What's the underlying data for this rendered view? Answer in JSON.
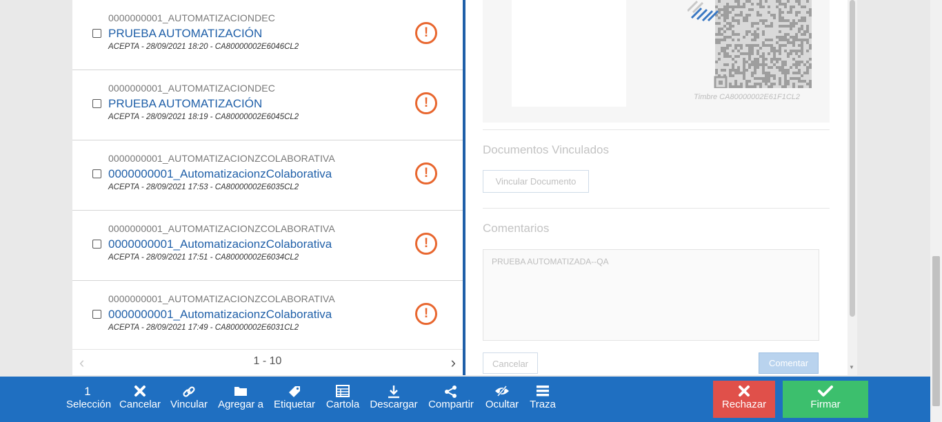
{
  "documents": [
    {
      "code": "0000000001_AUTOMATIZACIONDEC",
      "title": "PRUEBA AUTOMATIZACIÓN",
      "meta": "ACEPTA - 28/09/2021 18:20 - CA80000002E6046CL2"
    },
    {
      "code": "0000000001_AUTOMATIZACIONDEC",
      "title": "PRUEBA AUTOMATIZACIÓN",
      "meta": "ACEPTA - 28/09/2021 18:19 - CA80000002E6045CL2"
    },
    {
      "code": "0000000001_AUTOMATIZACIONZCOLABORATIVA",
      "title": "0000000001_AutomatizacionzColaborativa",
      "meta": "ACEPTA - 28/09/2021 17:53 - CA80000002E6035CL2"
    },
    {
      "code": "0000000001_AUTOMATIZACIONZCOLABORATIVA",
      "title": "0000000001_AutomatizacionzColaborativa",
      "meta": "ACEPTA - 28/09/2021 17:51 - CA80000002E6034CL2"
    },
    {
      "code": "0000000001_AUTOMATIZACIONZCOLABORATIVA",
      "title": "0000000001_AutomatizacionzColaborativa",
      "meta": "ACEPTA - 28/09/2021 17:49 - CA80000002E6031CL2"
    }
  ],
  "alert_glyph": "!",
  "pager": {
    "range": "1 - 10",
    "prev": "‹",
    "next": "›"
  },
  "detail": {
    "timbre": "Timbre CA80000002E61F1CL2",
    "linked_title": "Documentos Vinculados",
    "link_button": "Vincular Documento",
    "comments_title": "Comentarios",
    "comment_text": "PRUEBA AUTOMATIZADA--QA",
    "cancel_button": "Cancelar",
    "comment_button": "Comentar"
  },
  "toolbar": {
    "selection_count": "1",
    "selection_label": "Selección",
    "cancel": "Cancelar",
    "link": "Vincular",
    "add_to": "Agregar a",
    "tag": "Etiquetar",
    "cartola": "Cartola",
    "download": "Descargar",
    "share": "Compartir",
    "hide": "Ocultar",
    "trace": "Traza",
    "reject": "Rechazar",
    "sign": "Firmar"
  },
  "colors": {
    "accent": "#1f6fc1",
    "alert": "#e8662e",
    "reject": "#e0504a",
    "sign": "#3cbf6d"
  }
}
